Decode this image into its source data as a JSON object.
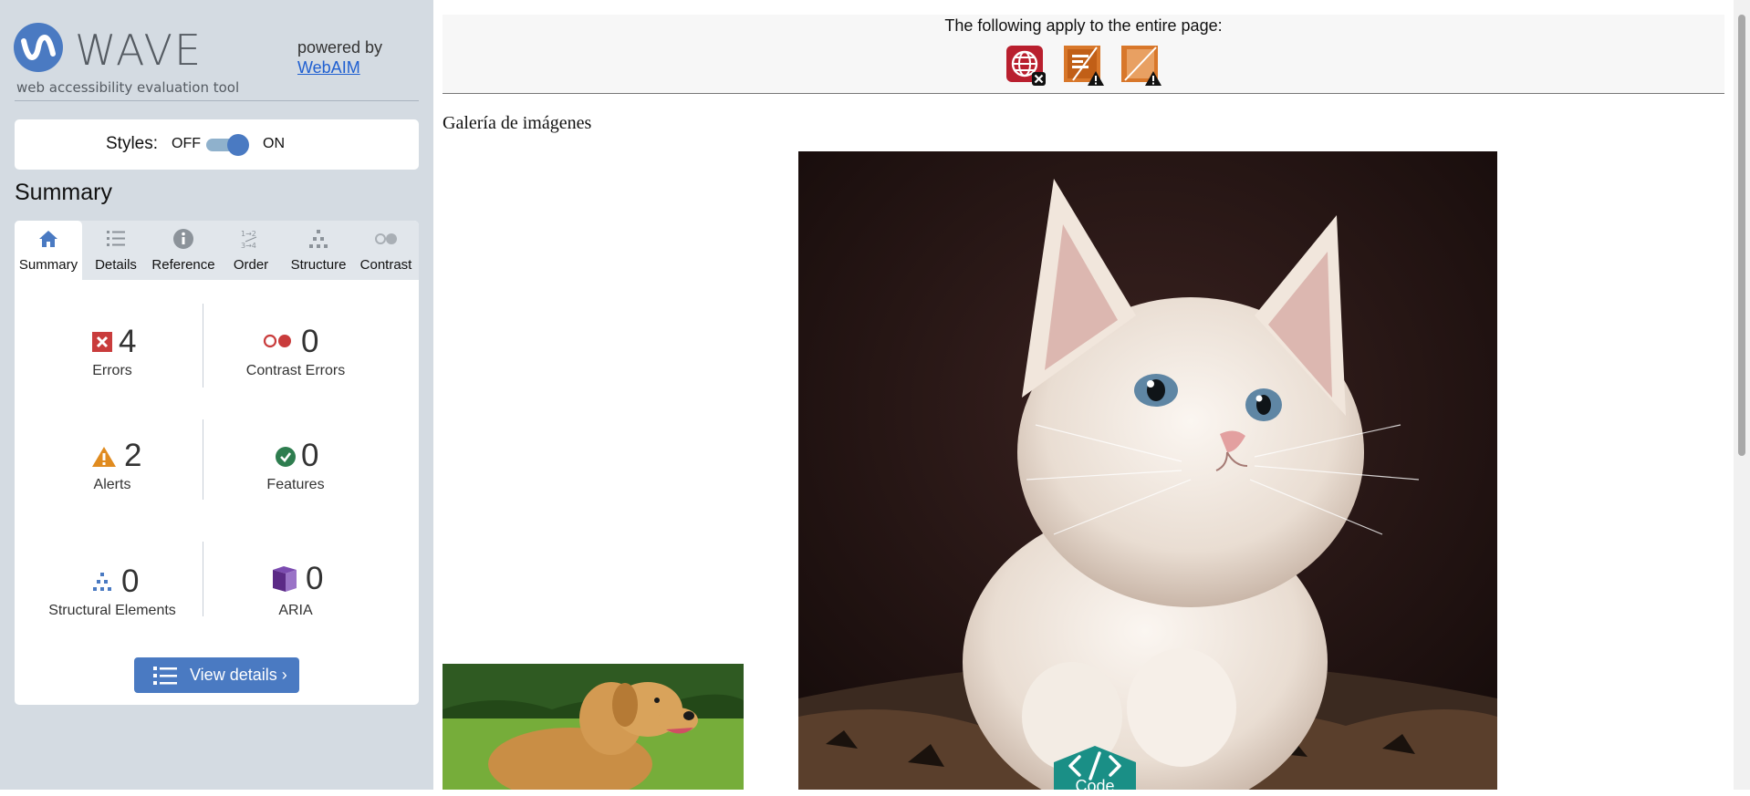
{
  "logo": {
    "word": "WAVE",
    "subtitle": "web accessibility evaluation tool",
    "powered_by": "powered by",
    "webaim_link": "WebAIM"
  },
  "styles_toggle": {
    "label": "Styles:",
    "off": "OFF",
    "on": "ON",
    "state": "on"
  },
  "summary_title": "Summary",
  "tabs": [
    {
      "label": "Summary",
      "icon": "home-icon",
      "active": true
    },
    {
      "label": "Details",
      "icon": "list-icon",
      "active": false
    },
    {
      "label": "Reference",
      "icon": "info-icon",
      "active": false
    },
    {
      "label": "Order",
      "icon": "order-icon",
      "active": false
    },
    {
      "label": "Structure",
      "icon": "structure-icon",
      "active": false
    },
    {
      "label": "Contrast",
      "icon": "contrast-icon",
      "active": false
    }
  ],
  "stats": {
    "errors": {
      "count": "4",
      "label": "Errors",
      "icon": "error-icon",
      "color": "#c93c3c"
    },
    "contrast_errors": {
      "count": "0",
      "label": "Contrast Errors",
      "icon": "contrast-error-icon",
      "color": "#c93c3c"
    },
    "alerts": {
      "count": "2",
      "label": "Alerts",
      "icon": "alert-icon",
      "color": "#e08b1f"
    },
    "features": {
      "count": "0",
      "label": "Features",
      "icon": "feature-icon",
      "color": "#2e7d4f"
    },
    "structural": {
      "count": "0",
      "label": "Structural Elements",
      "icon": "structural-icon",
      "color": "#4a7ac2"
    },
    "aria": {
      "count": "0",
      "label": "ARIA",
      "icon": "aria-icon",
      "color": "#5b2a86"
    }
  },
  "view_details": "View details ›",
  "main": {
    "top_bar_title": "The following apply to the entire page:",
    "page_icons": [
      "language-error-icon",
      "document-alert-icon",
      "noscript-alert-icon"
    ],
    "heading": "Galería de imágenes",
    "code_tab": "Code"
  },
  "colors": {
    "sidebar_bg": "#d4dbe2",
    "accent": "#4a7ac2",
    "code_tab": "#1a8f86"
  }
}
